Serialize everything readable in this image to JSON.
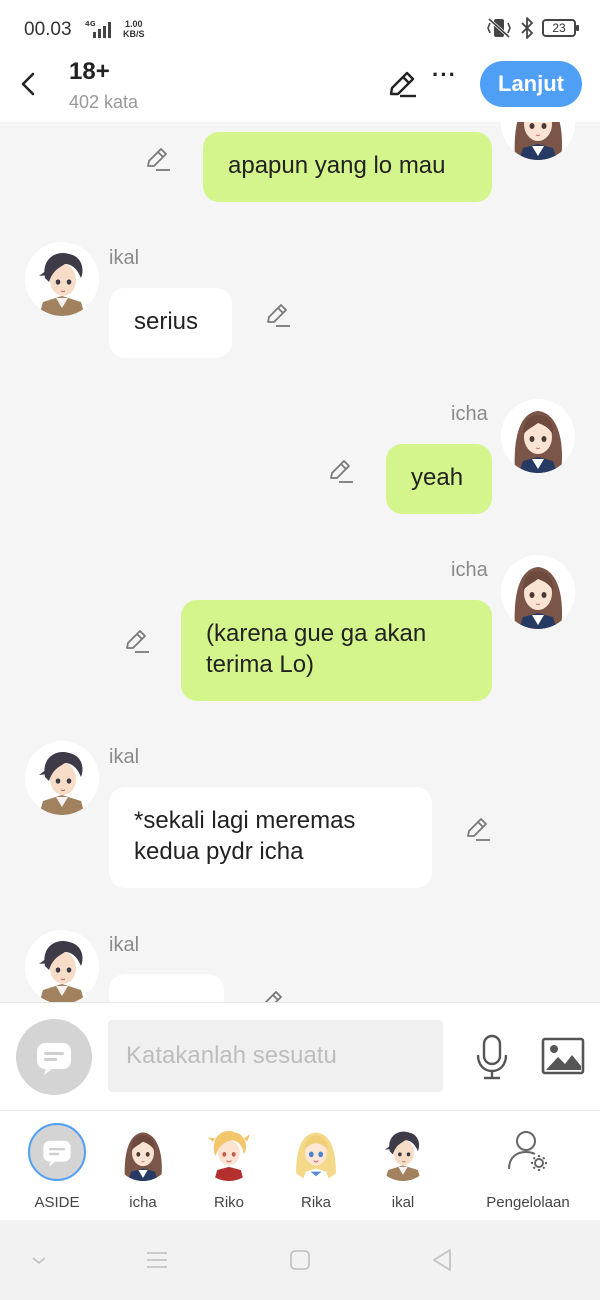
{
  "status": {
    "time": "00.03",
    "network": "4G",
    "speed_value": "1.00",
    "speed_unit": "KB/S",
    "battery": "23"
  },
  "header": {
    "title": "18+",
    "subtitle": "402 kata",
    "next_label": "Lanjut",
    "more": "···"
  },
  "messages": [
    {
      "sender": "",
      "text": "apapun yang lo mau",
      "side": "right"
    },
    {
      "sender": "ikal",
      "text": "serius",
      "side": "left"
    },
    {
      "sender": "icha",
      "text": "yeah",
      "side": "right"
    },
    {
      "sender": "icha",
      "text": "(karena gue ga akan terima Lo)",
      "side": "right"
    },
    {
      "sender": "ikal",
      "text": "*sekali lagi meremas kedua pydr icha",
      "side": "left"
    },
    {
      "sender": "ikal",
      "text": "",
      "side": "left"
    }
  ],
  "input": {
    "placeholder": "Katakanlah sesuatu"
  },
  "characters": [
    {
      "label": "ASIDE",
      "icon": "aside-icon"
    },
    {
      "label": "icha",
      "icon": "icha-avatar"
    },
    {
      "label": "Riko",
      "icon": "riko-avatar"
    },
    {
      "label": "Rika",
      "icon": "rika-avatar"
    },
    {
      "label": "ikal",
      "icon": "ikal-avatar"
    },
    {
      "label": "Pengelolaan",
      "icon": "user-settings-icon"
    }
  ],
  "colors": {
    "accent": "#4e9ff5",
    "my_bubble": "#d4f58b",
    "their_bubble": "#ffffff",
    "chat_bg": "#f5f5f5"
  }
}
